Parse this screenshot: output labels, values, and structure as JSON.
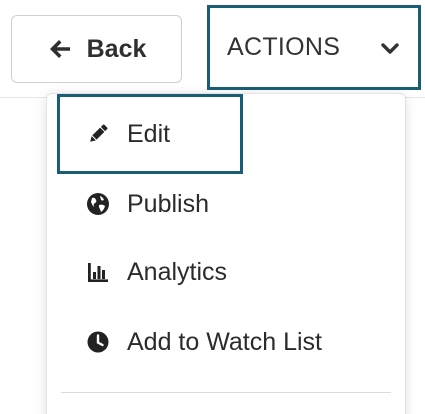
{
  "toolbar": {
    "back_label": "Back",
    "actions_label": "ACTIONS"
  },
  "menu": {
    "items": [
      {
        "label": "Edit",
        "icon": "pencil-icon"
      },
      {
        "label": "Publish",
        "icon": "globe-icon"
      },
      {
        "label": "Analytics",
        "icon": "bar-chart-icon"
      },
      {
        "label": "Add to Watch List",
        "icon": "clock-icon"
      }
    ],
    "focused_item": "Edit"
  },
  "colors": {
    "focus_outline": "#1a5e76",
    "text": "#2b2b2b",
    "border": "#cfcfcf"
  }
}
